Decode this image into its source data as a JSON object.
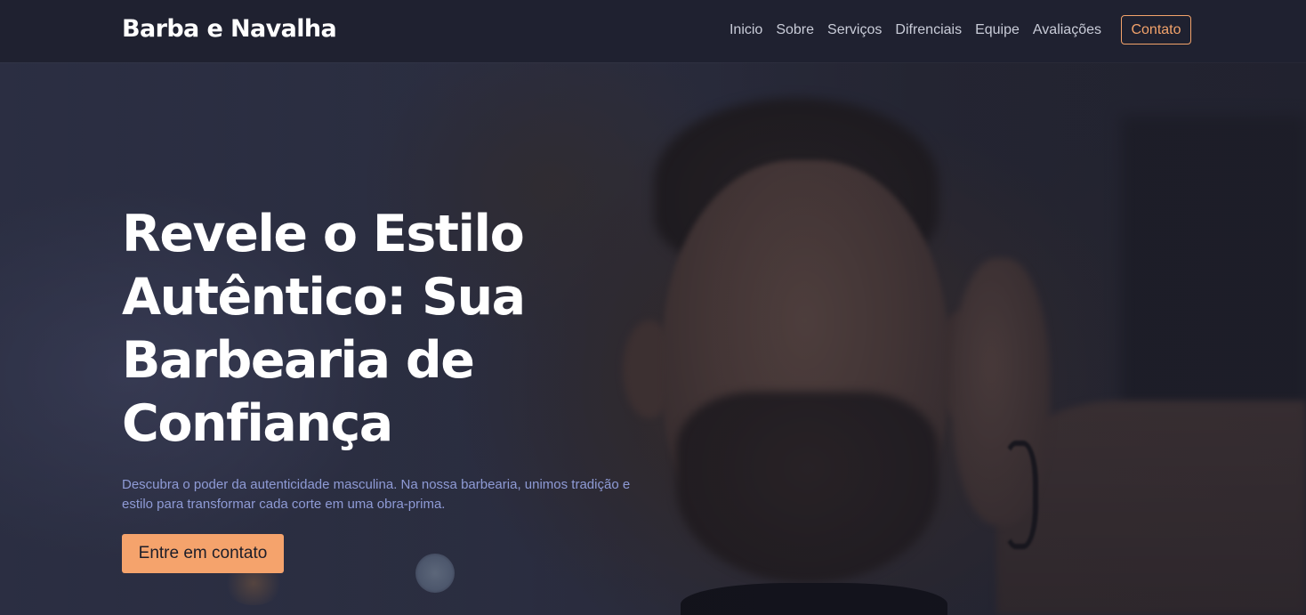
{
  "colors": {
    "header_bg": "#1f2130",
    "accent": "#f5a36c",
    "text_primary": "#ffffff",
    "nav_text": "#c9ccd8",
    "subtitle_text": "#8f9bd6"
  },
  "header": {
    "brand": "Barba e Navalha",
    "nav": [
      {
        "label": "Inicio"
      },
      {
        "label": "Sobre"
      },
      {
        "label": "Serviços"
      },
      {
        "label": "Difrenciais"
      },
      {
        "label": "Equipe"
      },
      {
        "label": "Avaliações"
      }
    ],
    "contact_label": "Contato"
  },
  "hero": {
    "headline": "Revele o Estilo Autêntico: Sua Barbearia de Confiança",
    "subtitle": "Descubra o poder da autenticidade masculina. Na nossa barbearia, unimos tradição e estilo para transformar cada corte em uma obra-prima.",
    "cta_label": "Entre em contato"
  }
}
